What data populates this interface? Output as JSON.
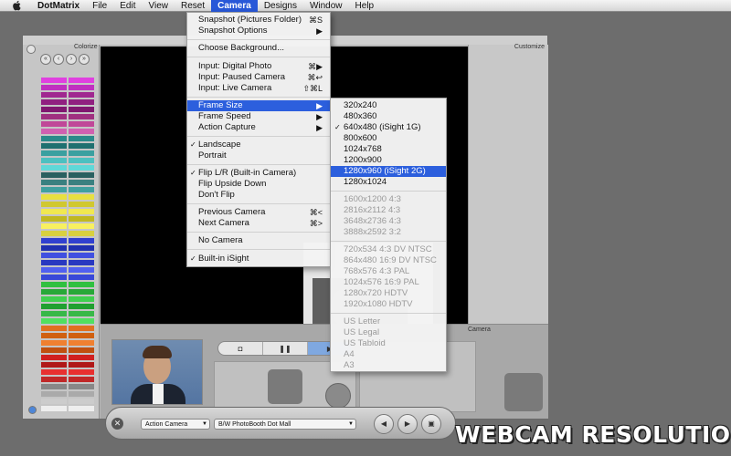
{
  "menubar": {
    "app_name": "DotMatrix",
    "items": [
      "File",
      "Edit",
      "View",
      "Reset",
      "Camera",
      "Designs",
      "Window",
      "Help"
    ],
    "active": "Camera"
  },
  "window": {
    "colorize_label": "Colorize",
    "customize_label": "Customize",
    "camera_label": "Camera"
  },
  "swatch_colors": [
    "#e040e0",
    "#c030c0",
    "#a02890",
    "#902080",
    "#801870",
    "#a03080",
    "#c04898",
    "#d060b0",
    "#2a8a8a",
    "#1f7070",
    "#3aa0a0",
    "#4cc0c0",
    "#5fd8d8",
    "#2a6060",
    "#3a8080",
    "#40a0a0",
    "#e8e040",
    "#d0c830",
    "#f0e850",
    "#c0b820",
    "#f8f060",
    "#d8d040",
    "#3040d0",
    "#2030b0",
    "#4050e0",
    "#2838c0",
    "#5060f0",
    "#3848d8",
    "#30c040",
    "#28a838",
    "#40d050",
    "#20a030",
    "#38b848",
    "#50e060",
    "#e07020",
    "#d06010",
    "#f08030",
    "#c05010",
    "#d02020",
    "#b01818",
    "#e83030",
    "#c02828",
    "#888888",
    "#aaaaaa",
    "#cccccc",
    "#eeeeee"
  ],
  "camera_menu": {
    "items": [
      {
        "label": "Snapshot (Pictures Folder)",
        "shortcut": "⌘S"
      },
      {
        "label": "Snapshot Options",
        "shortcut": "▶"
      },
      {
        "label": "Choose Background...",
        "shortcut": ""
      },
      {
        "label": "Input: Digital Photo",
        "shortcut": "⌘▶"
      },
      {
        "label": "Input: Paused Camera",
        "shortcut": "⌘↩"
      },
      {
        "label": "Input: Live Camera",
        "shortcut": "⇧⌘L"
      },
      {
        "label": "Frame Size",
        "shortcut": "▶"
      },
      {
        "label": "Frame Speed",
        "shortcut": "▶"
      },
      {
        "label": "Action Capture",
        "shortcut": "▶"
      },
      {
        "label": "Landscape",
        "shortcut": ""
      },
      {
        "label": "Portrait",
        "shortcut": ""
      },
      {
        "label": "Flip L/R (Built-in Camera)",
        "shortcut": ""
      },
      {
        "label": "Flip Upside Down",
        "shortcut": ""
      },
      {
        "label": "Don't Flip",
        "shortcut": ""
      },
      {
        "label": "Previous Camera",
        "shortcut": "⌘<"
      },
      {
        "label": "Next Camera",
        "shortcut": "⌘>"
      },
      {
        "label": "No Camera",
        "shortcut": ""
      },
      {
        "label": "Built-in iSight",
        "shortcut": ""
      }
    ],
    "checkmark": "✓"
  },
  "frame_size_menu": {
    "items": [
      "320x240",
      "480x360",
      "640x480 (iSight 1G)",
      "800x600",
      "1024x768",
      "1200x900",
      "1280x960 (iSight 2G)",
      "1280x1024",
      "1600x1200 4:3",
      "2816x2112 4:3",
      "3648x2736 4:3",
      "3888x2592 3:2",
      "720x534 4:3 DV NTSC",
      "864x480 16:9 DV NTSC",
      "768x576 4:3 PAL",
      "1024x576 16:9 PAL",
      "1280x720 HDTV",
      "1920x1080 HDTV",
      "US Letter",
      "US Legal",
      "US Tabloid",
      "A4",
      "A3"
    ],
    "checkmark": "✓"
  },
  "toolbar": {
    "close_glyph": "✕",
    "source_select": "Action Camera",
    "style_select": "B/W PhotoBooth Dot Mall",
    "prev_glyph": "◀",
    "next_glyph": "▶"
  },
  "caption": "WEBCAM RESOLUTION"
}
